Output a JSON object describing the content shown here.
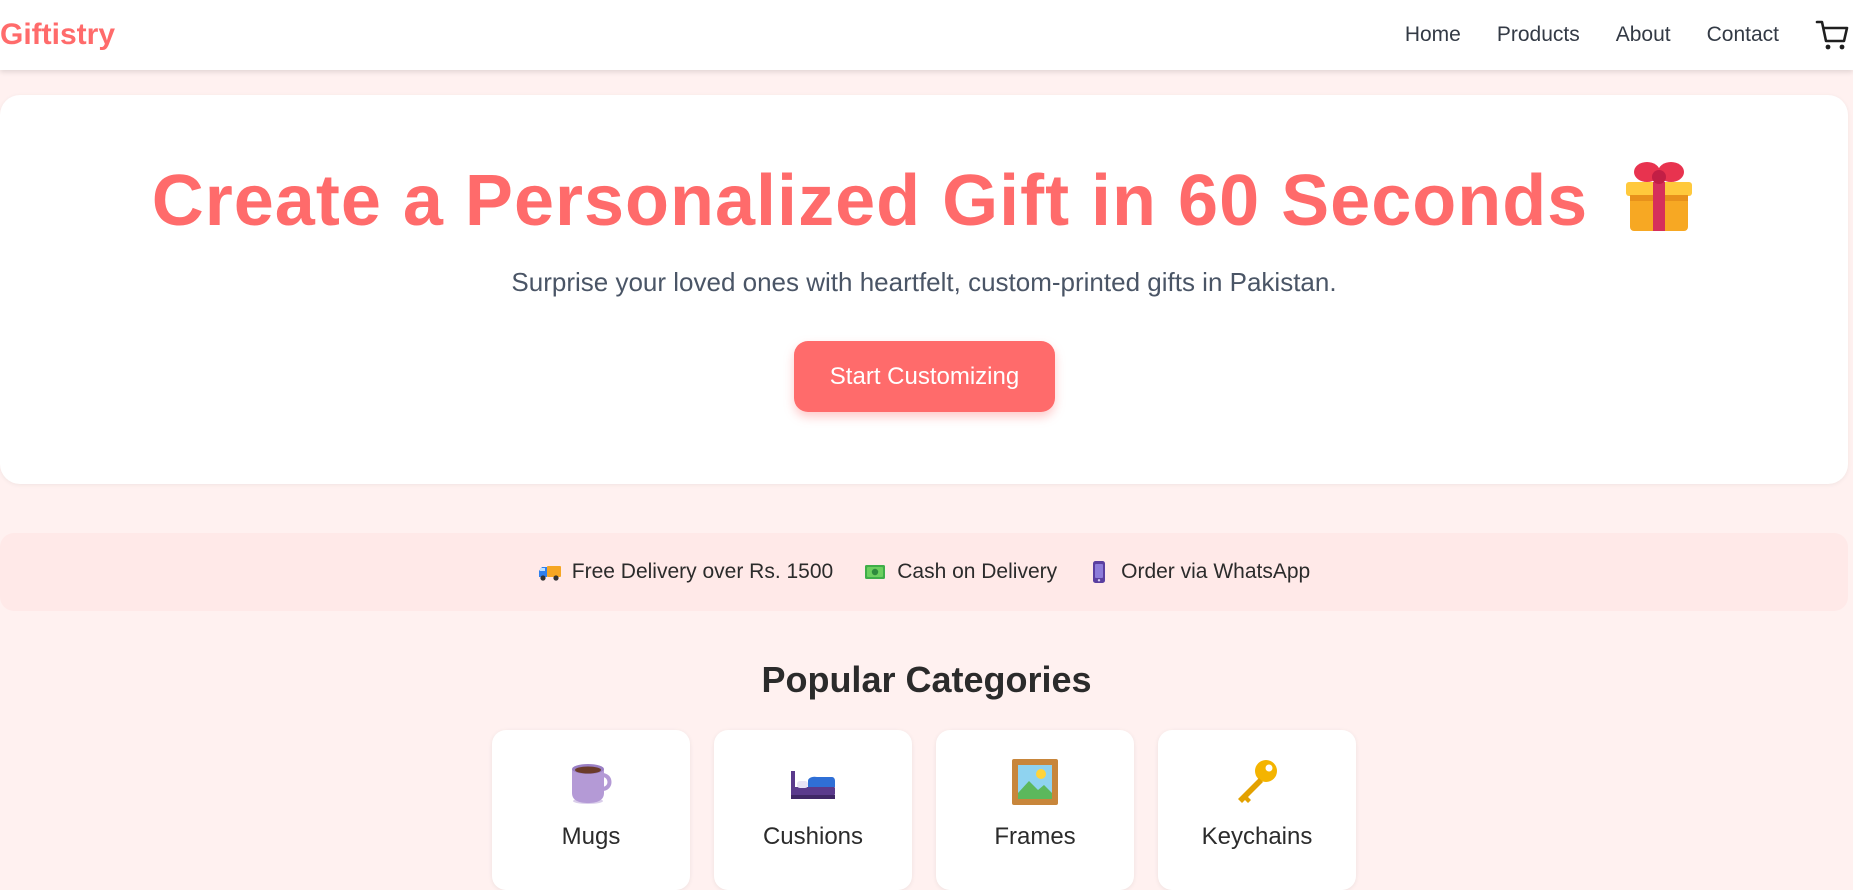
{
  "header": {
    "brand": "Giftistry",
    "nav": [
      "Home",
      "Products",
      "About",
      "Contact"
    ],
    "cart_icon": "cart-icon"
  },
  "hero": {
    "title": "Create a Personalized Gift in 60 Seconds",
    "title_icon": "gift-icon",
    "subtitle": "Surprise your loved ones with heartfelt, custom-printed gifts in Pakistan.",
    "cta_label": "Start Customizing"
  },
  "benefits": [
    {
      "icon": "delivery-truck-icon",
      "label": "Free Delivery over Rs. 1500"
    },
    {
      "icon": "cash-icon",
      "label": "Cash on Delivery"
    },
    {
      "icon": "phone-icon",
      "label": "Order via WhatsApp"
    }
  ],
  "categories": {
    "title": "Popular Categories",
    "items": [
      {
        "icon": "mug-icon",
        "label": "Mugs"
      },
      {
        "icon": "cushion-bed-icon",
        "label": "Cushions"
      },
      {
        "icon": "picture-frame-icon",
        "label": "Frames"
      },
      {
        "icon": "key-icon",
        "label": "Keychains"
      }
    ]
  },
  "colors": {
    "accent": "#ff6b6b",
    "page_background": "#fff1f0",
    "strip_background": "#ffe9e8",
    "text_dark": "#2b2b2b",
    "text_muted": "#4a5566"
  }
}
